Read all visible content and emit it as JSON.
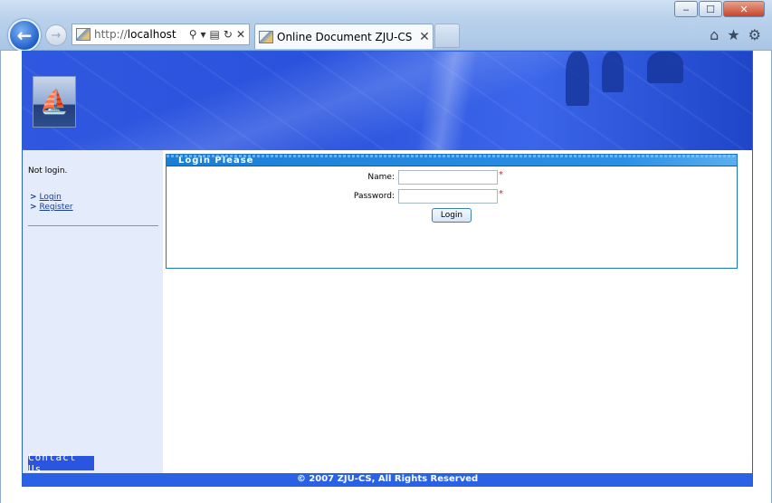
{
  "browser": {
    "window_buttons": {
      "minimize": "‒",
      "maximize": "☐",
      "close": "✕"
    },
    "address": {
      "protocol": "http://",
      "host": "localhost"
    },
    "tab": {
      "title": "Online Document ZJU-CS",
      "close": "✕"
    },
    "icons": [
      "back-arrow-icon",
      "forward-arrow-icon",
      "search-icon",
      "dropdown-icon",
      "compatibility-icon",
      "refresh-icon",
      "stop-icon",
      "home-icon",
      "favorites-star-icon",
      "settings-gear-icon"
    ]
  },
  "sidebar": {
    "status": "Not login.",
    "links": [
      {
        "arrow": ">",
        "label": "Login"
      },
      {
        "arrow": ">",
        "label": "Register"
      }
    ],
    "contact": "Contact Us"
  },
  "login": {
    "title": "Login Please",
    "name_label": "Name:",
    "password_label": "Password:",
    "required_mark": "*",
    "name_value": "",
    "password_value": "",
    "submit": "Login"
  },
  "footer": {
    "text": "© 2007 ZJU-CS, All Rights Reserved"
  },
  "colors": {
    "banner": "#2f57e0",
    "sidebar_bg": "#e4ebfa",
    "footer_bg": "#2a62e6",
    "login_header": "#1b7fd6",
    "required": "#e02020"
  }
}
